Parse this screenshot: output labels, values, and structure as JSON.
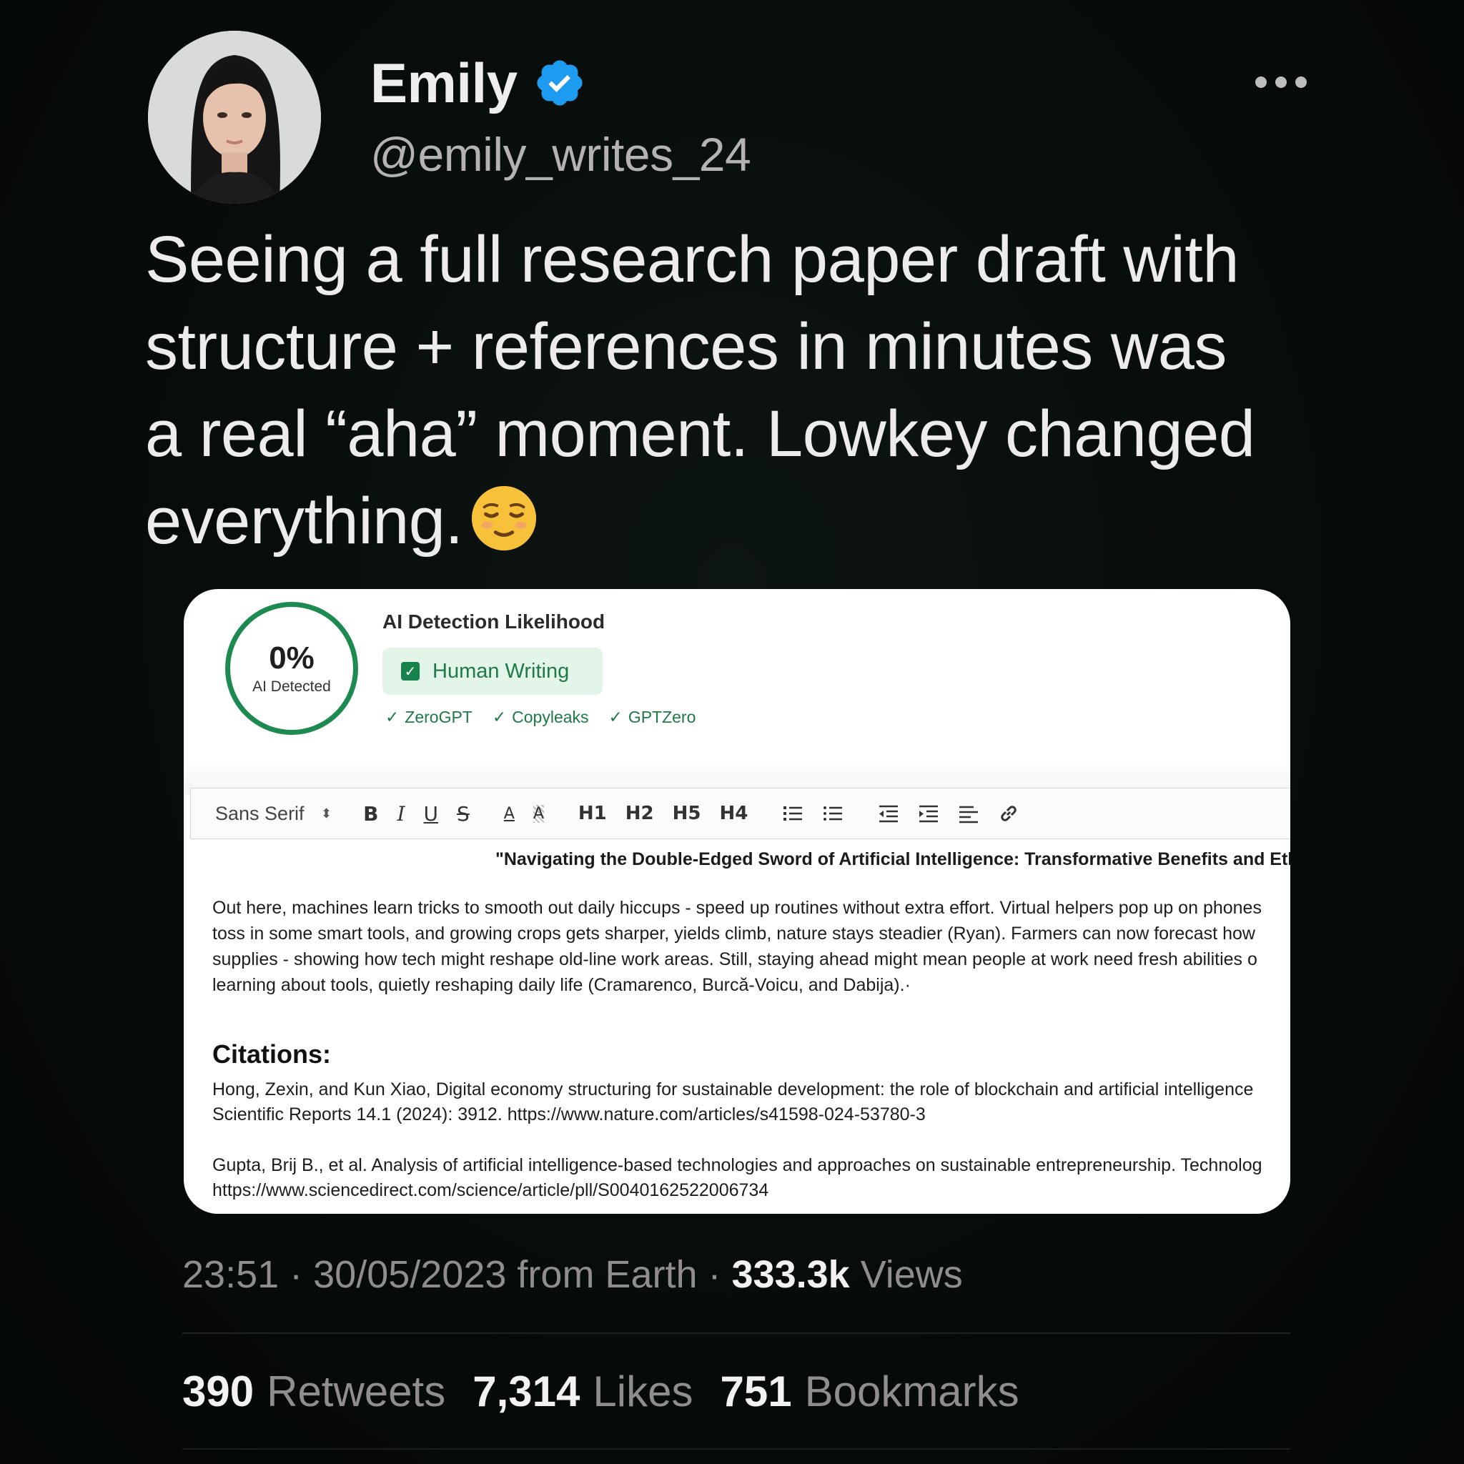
{
  "author": {
    "name": "Emily",
    "handle": "@emily_writes_24"
  },
  "tweet": {
    "text_lines": [
      "Seeing a full research paper draft with",
      "structure + references in minutes was",
      "a real “aha” moment. Lowkey changed",
      "everything."
    ],
    "emoji": "relieved-face-emoji"
  },
  "detector": {
    "percent": "0%",
    "percent_label": "AI Detected",
    "title": "AI Detection Likelihood",
    "verdict": "Human Writing",
    "checks": [
      "ZeroGPT",
      "Copyleaks",
      "GPTZero"
    ],
    "accent_color": "#1c8a51"
  },
  "toolbar": {
    "font_select": "Sans Serif",
    "buttons": [
      "B",
      "I",
      "U",
      "S",
      "A",
      "A",
      "H1",
      "H2",
      "H5",
      "H4"
    ]
  },
  "document": {
    "title": "\"Navigating the Double-Edged Sword of Artificial Intelligence: Transformative Benefits and Eth",
    "paragraph": [
      "Out here, machines learn tricks to smooth out daily hiccups - speed up routines without extra effort. Virtual helpers pop up on phones",
      "toss in some smart tools, and growing crops gets sharper, yields climb, nature stays steadier (Ryan). Farmers can now forecast how",
      "supplies - showing how tech might reshape old-line work areas. Still, staying ahead might mean people at work need fresh abilities o",
      "learning about tools, quietly reshaping daily life (Cramarenco, Burcă-Voicu, and Dabija).·"
    ],
    "citations_heading": "Citations:",
    "citations": [
      {
        "line1": "Hong, Zexin, and Kun Xiao, Digital economy structuring for sustainable development: the role of blockchain and artificial intelligence",
        "line2": "Scientific Reports 14.1 (2024): 3912. https://www.nature.com/articles/s41598-024-53780-3"
      },
      {
        "line1": "Gupta, Brij B., et al. Analysis of artificial intelligence-based technologies and approaches on sustainable entrepreneurship. Technolog",
        "line2": "https://www.sciencedirect.com/science/article/pll/S0040162522006734"
      }
    ]
  },
  "meta": {
    "time": "23:51",
    "date": "30/05/2023",
    "source": "from Earth",
    "views_count": "333.3k",
    "views_label": "Views"
  },
  "stats": {
    "retweets_count": "390",
    "retweets_label": "Retweets",
    "likes_count": "7,314",
    "likes_label": "Likes",
    "bookmarks_count": "751",
    "bookmarks_label": "Bookmarks"
  }
}
